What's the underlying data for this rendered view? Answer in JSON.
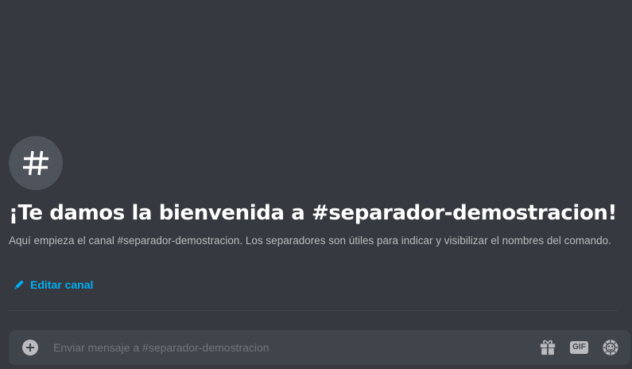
{
  "welcome": {
    "title": "¡Te damos la bienvenida a #separador-demostracion!",
    "description": "Aquí empieza el canal #separador-demostracion. Los separadores son útiles para indicar y visibilizar el nombres del comando.",
    "edit_label": "Editar canal",
    "channel_icon": "hashtag-icon"
  },
  "composer": {
    "placeholder": "Enviar mensaje a #separador-demostracion",
    "value": "",
    "gif_label": "GIF",
    "icons": [
      "add-circle-icon",
      "gift-icon",
      "gif-icon",
      "emoji-icon"
    ]
  },
  "colors": {
    "background": "#36393f",
    "input_background": "#40444b",
    "link": "#00aff4",
    "icon_circle": "#4f545c",
    "muted_text": "#b9bbbe"
  }
}
